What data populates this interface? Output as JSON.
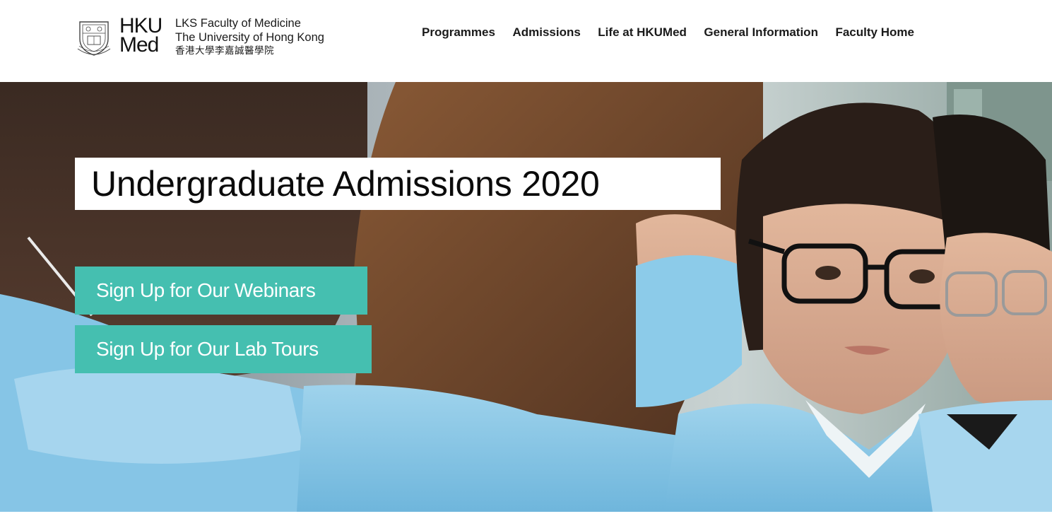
{
  "brand": {
    "logo_word_line1": "HKU",
    "logo_word_line2": "Med",
    "name_line1": "LKS Faculty of Medicine",
    "name_line2": "The University of Hong Kong",
    "name_line3": "香港大學李嘉誠醫學院"
  },
  "nav": {
    "items": [
      "Programmes",
      "Admissions",
      "Life at HKUMed",
      "General Information",
      "Faculty Home"
    ]
  },
  "hero": {
    "title": "Undergraduate Admissions 2020",
    "cta_webinars": "Sign Up for Our Webinars",
    "cta_lab_tours": "Sign Up for Our Lab Tours"
  },
  "colors": {
    "accent": "#45bfb0",
    "text": "#1a1a1a",
    "background": "#ffffff"
  }
}
